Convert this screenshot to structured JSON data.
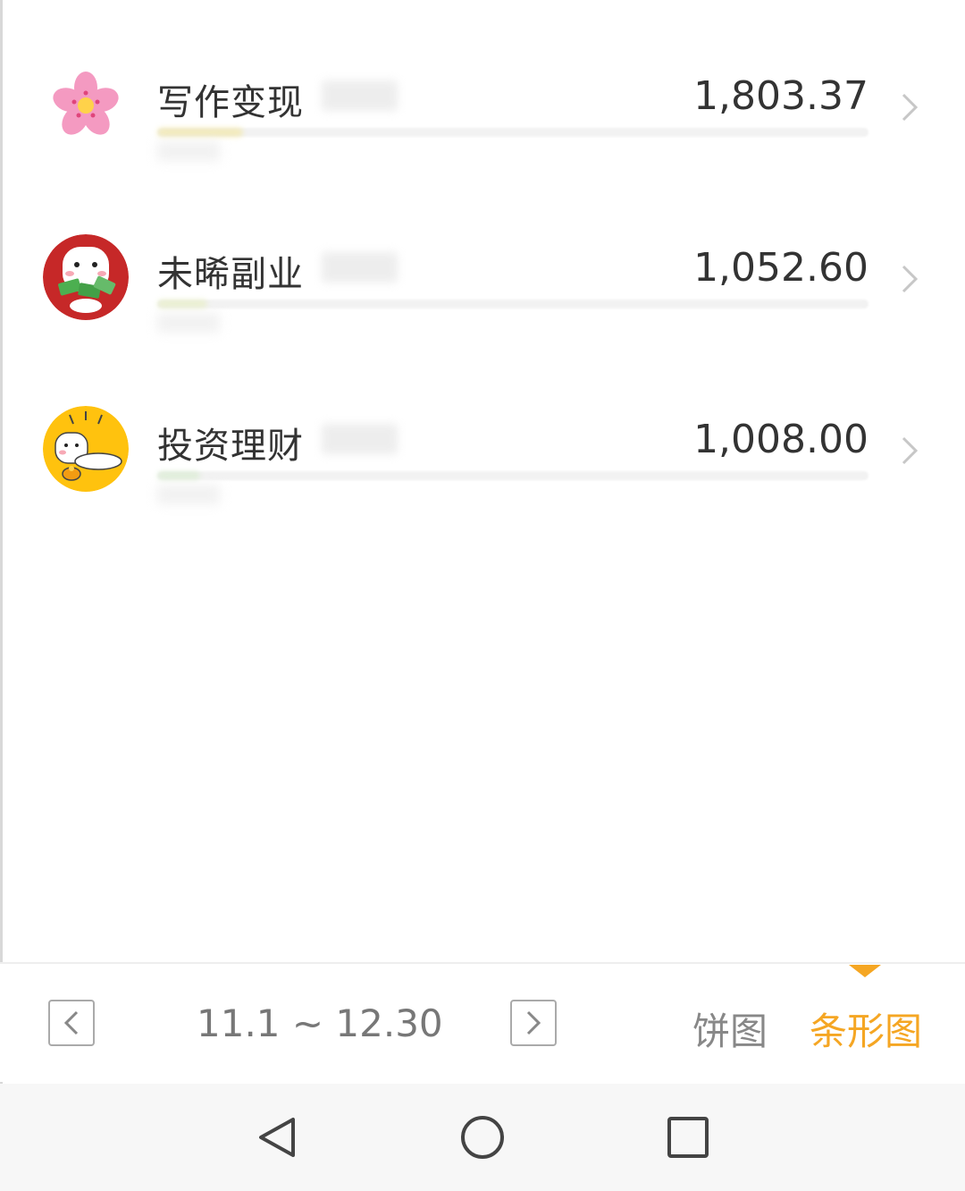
{
  "items": [
    {
      "label": "写作变现",
      "amount": "1,803.37",
      "avatar": "flower-icon",
      "fill_pct": 12
    },
    {
      "label": "未晞副业",
      "amount": "1,052.60",
      "avatar": "money-mascot-icon",
      "fill_pct": 7
    },
    {
      "label": "投资理财",
      "amount": "1,008.00",
      "avatar": "mascot-icon",
      "fill_pct": 6
    }
  ],
  "toolbar": {
    "date_range": "11.1 ~ 12.30",
    "pie_label": "饼图",
    "bar_label": "条形图",
    "selected": "bar"
  },
  "colors": {
    "accent": "#f5a623",
    "text": "#333333",
    "muted": "#777777"
  }
}
